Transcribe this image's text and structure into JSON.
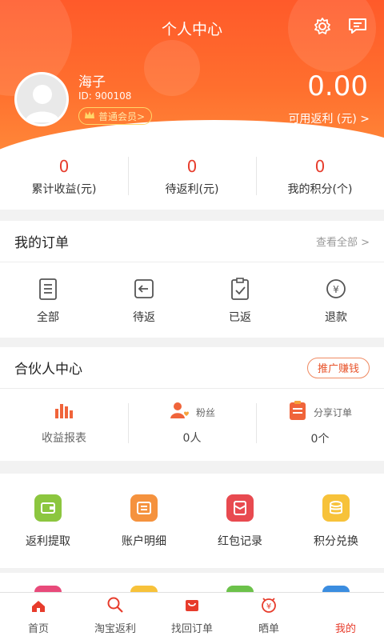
{
  "header": {
    "title": "个人中心",
    "settings_icon": "gear-icon",
    "message_icon": "message-icon"
  },
  "user": {
    "name": "海子",
    "id": "ID: 900108",
    "member_level": "普通会员>",
    "balance": "0.00",
    "balance_label": "可用返利 (元) >"
  },
  "stats": [
    {
      "value": "0",
      "label": "累计收益(元)"
    },
    {
      "value": "0",
      "label": "待返利(元)"
    },
    {
      "value": "0",
      "label": "我的积分(个)"
    }
  ],
  "orders": {
    "title": "我的订单",
    "view_all": "查看全部 >",
    "items": [
      {
        "label": "全部",
        "icon": "list-icon"
      },
      {
        "label": "待返",
        "icon": "return-icon"
      },
      {
        "label": "已返",
        "icon": "check-clipboard-icon"
      },
      {
        "label": "退款",
        "icon": "refund-icon"
      }
    ]
  },
  "partner": {
    "title": "合伙人中心",
    "promo_button": "推广赚钱",
    "earnings_report": "收益报表",
    "fans_label": "粉丝",
    "fans_value": "0人",
    "shared_orders_label": "分享订单",
    "shared_orders_value": "0个"
  },
  "tools": [
    {
      "label": "返利提取",
      "icon": "wallet-icon",
      "color": "#8cc63f"
    },
    {
      "label": "账户明细",
      "icon": "detail-icon",
      "color": "#f5923e"
    },
    {
      "label": "红包记录",
      "icon": "red-packet-icon",
      "color": "#e84a50"
    },
    {
      "label": "积分兑换",
      "icon": "coins-icon",
      "color": "#f7c23a"
    }
  ],
  "tabbar": [
    {
      "label": "首页",
      "icon": "home-icon"
    },
    {
      "label": "淘宝返利",
      "icon": "search-icon"
    },
    {
      "label": "找回订单",
      "icon": "bag-icon"
    },
    {
      "label": "晒单",
      "icon": "share-order-icon"
    },
    {
      "label": "我的",
      "icon": "profile-icon",
      "active": true
    }
  ],
  "colors": {
    "accent": "#e73c2c",
    "header_gradient_start": "#ff5a2a",
    "header_gradient_end": "#ff8a3a"
  }
}
